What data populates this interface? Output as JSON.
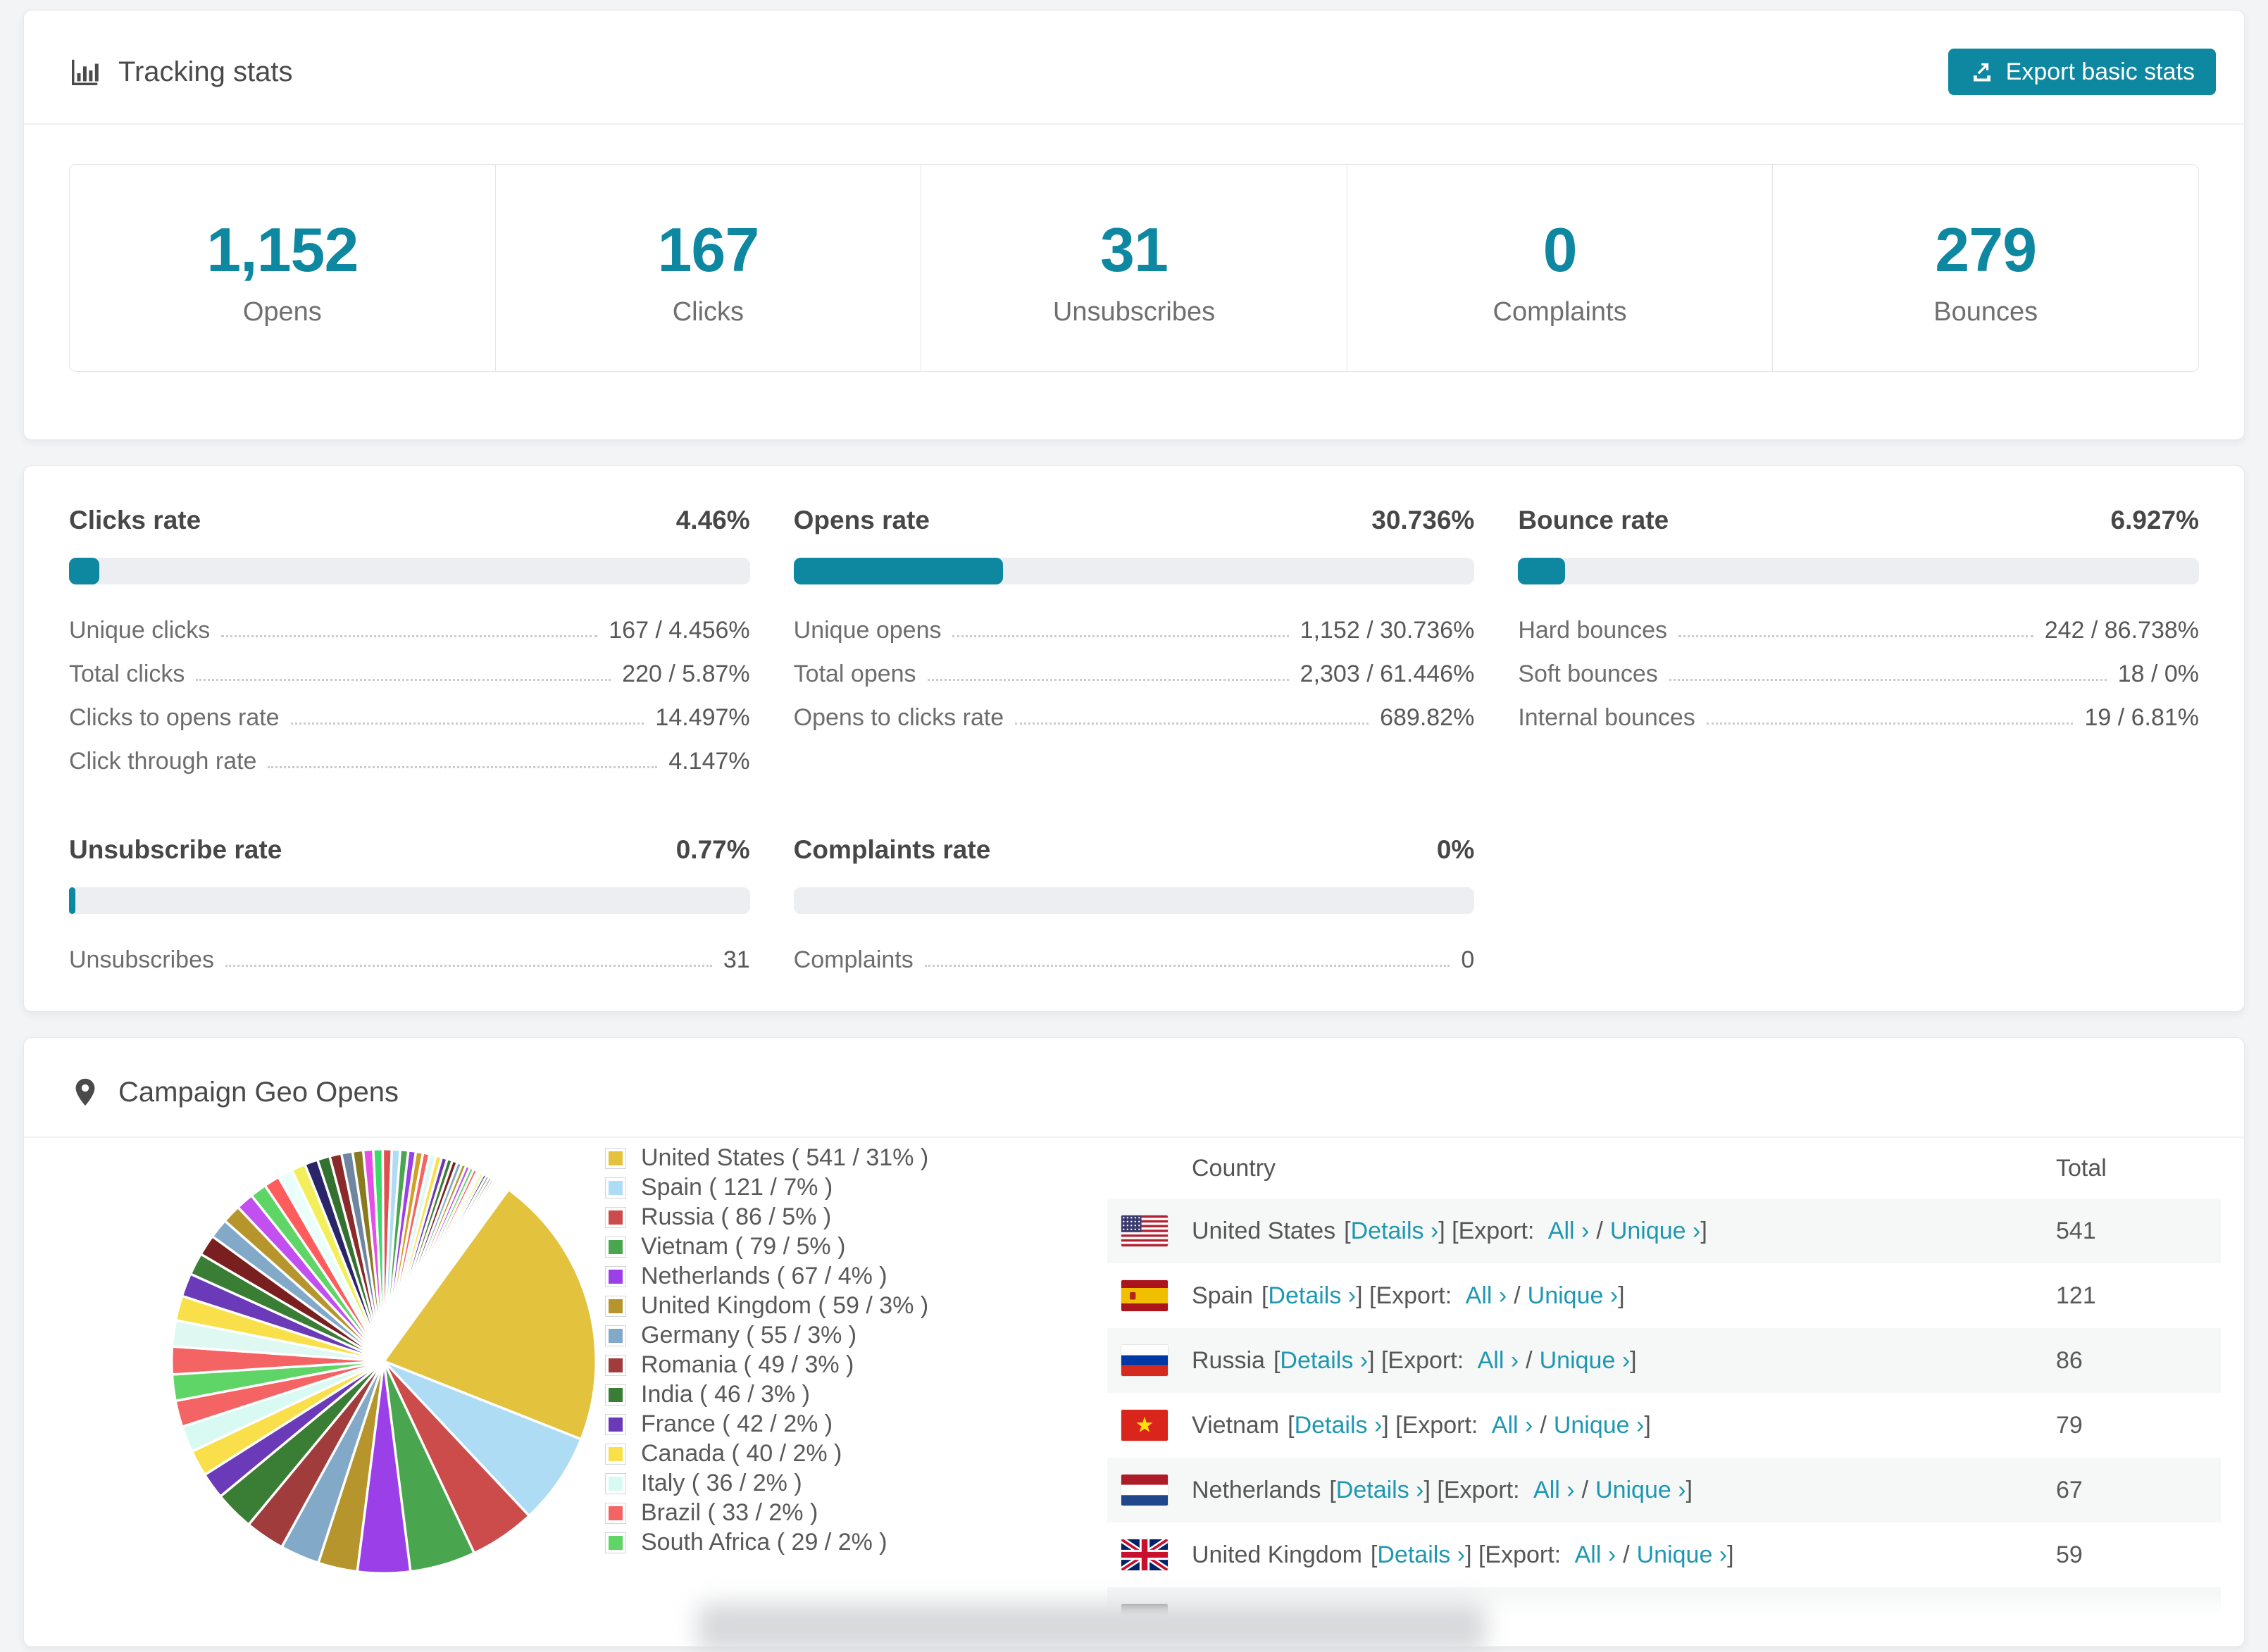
{
  "colors": {
    "accent": "#0e87a1",
    "link": "#1f97b1",
    "page_bg": "#f3f4f6",
    "progress_track": "#eceef1",
    "table_alt_row": "#f6f7f7"
  },
  "tracking": {
    "title": "Tracking stats",
    "export_label": "Export basic stats",
    "stats": [
      {
        "value": "1,152",
        "label": "Opens"
      },
      {
        "value": "167",
        "label": "Clicks"
      },
      {
        "value": "31",
        "label": "Unsubscribes"
      },
      {
        "value": "0",
        "label": "Complaints"
      },
      {
        "value": "279",
        "label": "Bounces"
      }
    ]
  },
  "rates": [
    {
      "title": "Clicks rate",
      "value": "4.46%",
      "percent": 4.46,
      "rows": [
        {
          "label": "Unique clicks",
          "value": "167 / 4.456%"
        },
        {
          "label": "Total clicks",
          "value": "220 / 5.87%"
        },
        {
          "label": "Clicks to opens rate",
          "value": "14.497%"
        },
        {
          "label": "Click through rate",
          "value": "4.147%"
        }
      ]
    },
    {
      "title": "Opens rate",
      "value": "30.736%",
      "percent": 30.736,
      "rows": [
        {
          "label": "Unique opens",
          "value": "1,152 / 30.736%"
        },
        {
          "label": "Total opens",
          "value": "2,303 / 61.446%"
        },
        {
          "label": "Opens to clicks rate",
          "value": "689.82%"
        }
      ]
    },
    {
      "title": "Bounce rate",
      "value": "6.927%",
      "percent": 6.927,
      "rows": [
        {
          "label": "Hard bounces",
          "value": "242 / 86.738%"
        },
        {
          "label": "Soft bounces",
          "value": "18 / 0%"
        },
        {
          "label": "Internal bounces",
          "value": "19 / 6.81%"
        }
      ]
    },
    {
      "title": "Unsubscribe rate",
      "value": "0.77%",
      "percent": 0.77,
      "rows": [
        {
          "label": "Unsubscribes",
          "value": "31"
        }
      ]
    },
    {
      "title": "Complaints rate",
      "value": "0%",
      "percent": 0,
      "rows": [
        {
          "label": "Complaints",
          "value": "0"
        }
      ]
    }
  ],
  "geo": {
    "title": "Campaign Geo Opens",
    "chart_data": {
      "type": "pie",
      "title": "Campaign Geo Opens",
      "start_angle_deg": 0,
      "direction": "clockwise",
      "legend_position": "right",
      "legend_format": "{label} ( {value} / {percent}% )",
      "slice_gap_color": "#ffffff",
      "series": [
        {
          "label": "United States",
          "value": 541,
          "percent": 31,
          "color": "#e3c23e"
        },
        {
          "label": "Spain",
          "value": 121,
          "percent": 7,
          "color": "#aedcf5"
        },
        {
          "label": "Russia",
          "value": 86,
          "percent": 5,
          "color": "#cc4b4b"
        },
        {
          "label": "Vietnam",
          "value": 79,
          "percent": 5,
          "color": "#4aa64e"
        },
        {
          "label": "Netherlands",
          "value": 67,
          "percent": 4,
          "color": "#9b3fe8"
        },
        {
          "label": "United Kingdom",
          "value": 59,
          "percent": 3,
          "color": "#b5952c"
        },
        {
          "label": "Germany",
          "value": 55,
          "percent": 3,
          "color": "#82aac8"
        },
        {
          "label": "Romania",
          "value": 49,
          "percent": 3,
          "color": "#a03c3c"
        },
        {
          "label": "India",
          "value": 46,
          "percent": 3,
          "color": "#3a7d34"
        },
        {
          "label": "France",
          "value": 42,
          "percent": 2,
          "color": "#6a3ab8"
        },
        {
          "label": "Canada",
          "value": 40,
          "percent": 2,
          "color": "#f9e04b"
        },
        {
          "label": "Italy",
          "value": 36,
          "percent": 2,
          "color": "#d9faf3"
        },
        {
          "label": "Brazil",
          "value": 33,
          "percent": 2,
          "color": "#f56464"
        },
        {
          "label": "South Africa",
          "value": 29,
          "percent": 2,
          "color": "#5fd467"
        }
      ],
      "unlabeled_tail": {
        "total_percent": 36,
        "slice_count": 50,
        "start_percent": 2.1,
        "decay": 0.945,
        "palette": [
          "#f56464",
          "#dff8f2",
          "#f9e04b",
          "#6a3ab8",
          "#3a7d34",
          "#7a1f1f",
          "#82aac8",
          "#b5952c",
          "#c24ff0",
          "#5fd467",
          "#ff5d5d",
          "#eafffb",
          "#f3ef5a",
          "#2a2468",
          "#33712e",
          "#8a2a2a",
          "#6e86a0",
          "#8a7a1f",
          "#e44fe4",
          "#3adb6a",
          "#e05050",
          "#aedcf5",
          "#4aa64e",
          "#9b3fe8",
          "#cfa227"
        ]
      }
    },
    "table": {
      "columns": {
        "country": "Country",
        "total": "Total"
      },
      "links": {
        "open": "[",
        "details": "Details ›",
        "close_export": "] [Export:",
        "all": "All ›",
        "slash": "/",
        "unique": "Unique ›",
        "close": "]"
      },
      "rows": [
        {
          "country": "United States",
          "total": "541",
          "flag": "us",
          "partial": false
        },
        {
          "country": "Spain",
          "total": "121",
          "flag": "es",
          "partial": false
        },
        {
          "country": "Russia",
          "total": "86",
          "flag": "ru",
          "partial": false
        },
        {
          "country": "Vietnam",
          "total": "79",
          "flag": "vn",
          "partial": false
        },
        {
          "country": "Netherlands",
          "total": "67",
          "flag": "nl",
          "partial": false
        },
        {
          "country": "United Kingdom",
          "total": "59",
          "flag": "gb",
          "partial": false
        },
        {
          "country": "",
          "total": "",
          "flag": "de",
          "partial": true
        }
      ]
    }
  }
}
